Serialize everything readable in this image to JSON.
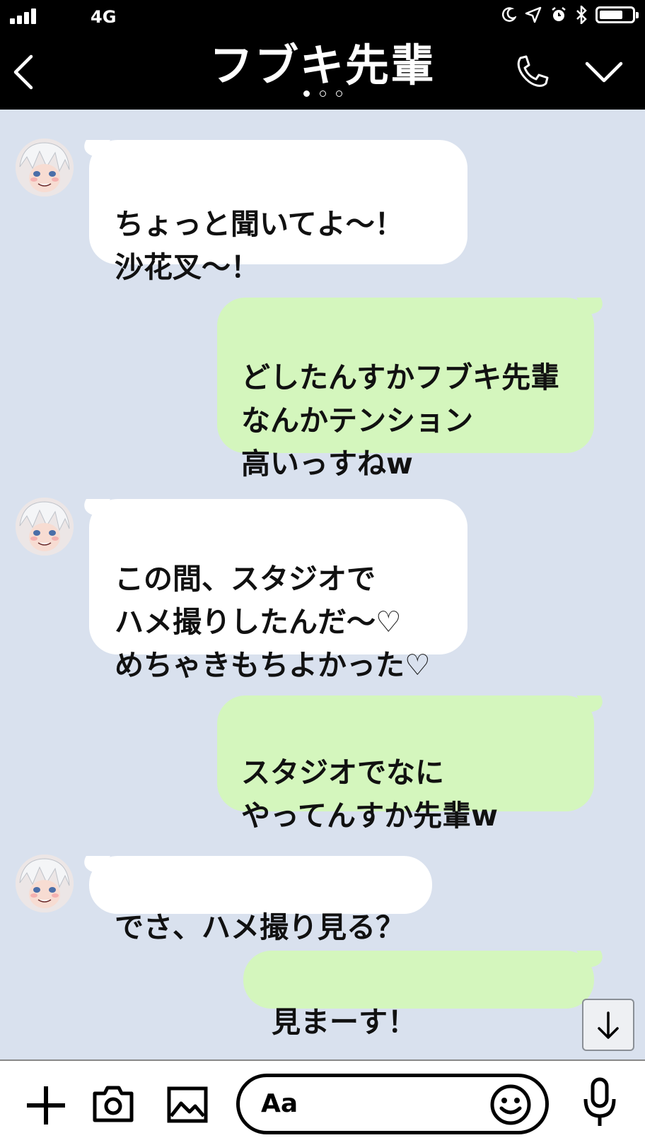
{
  "status_bar": {
    "network": "4G",
    "battery_level": 0.72
  },
  "header": {
    "title": "フブキ先輩",
    "page_count": 3,
    "active_page": 1
  },
  "messages": [
    {
      "sender": "フブキ先輩",
      "direction": "incoming",
      "text": "ちょっと聞いてよ～！\n沙花叉～！"
    },
    {
      "sender": "me",
      "direction": "outgoing",
      "text": "どしたんすかフブキ先輩\nなんかテンション\n高いっすねw"
    },
    {
      "sender": "フブキ先輩",
      "direction": "incoming",
      "text": "この間、スタジオで\nハメ撮りしたんだ～♡\nめちゃきもちよかった♡"
    },
    {
      "sender": "me",
      "direction": "outgoing",
      "text": "スタジオでなに\nやってんすか先輩w"
    },
    {
      "sender": "フブキ先輩",
      "direction": "incoming",
      "text": "でさ、ハメ撮り見る？"
    },
    {
      "sender": "me",
      "direction": "outgoing",
      "text": "見まーす！"
    }
  ],
  "input": {
    "placeholder": "Aa"
  },
  "icons": {
    "back": "chevron-left-icon",
    "call": "phone-icon",
    "menu": "chevron-down-icon",
    "add": "plus-icon",
    "camera": "camera-icon",
    "gallery": "image-icon",
    "emoji": "smiley-icon",
    "mic": "microphone-icon",
    "scroll_down": "arrow-down-icon"
  },
  "colors": {
    "header_bg": "#000000",
    "chat_bg": "#d9e1ee",
    "incoming_bubble": "#ffffff",
    "outgoing_bubble": "#d4f6bd"
  }
}
